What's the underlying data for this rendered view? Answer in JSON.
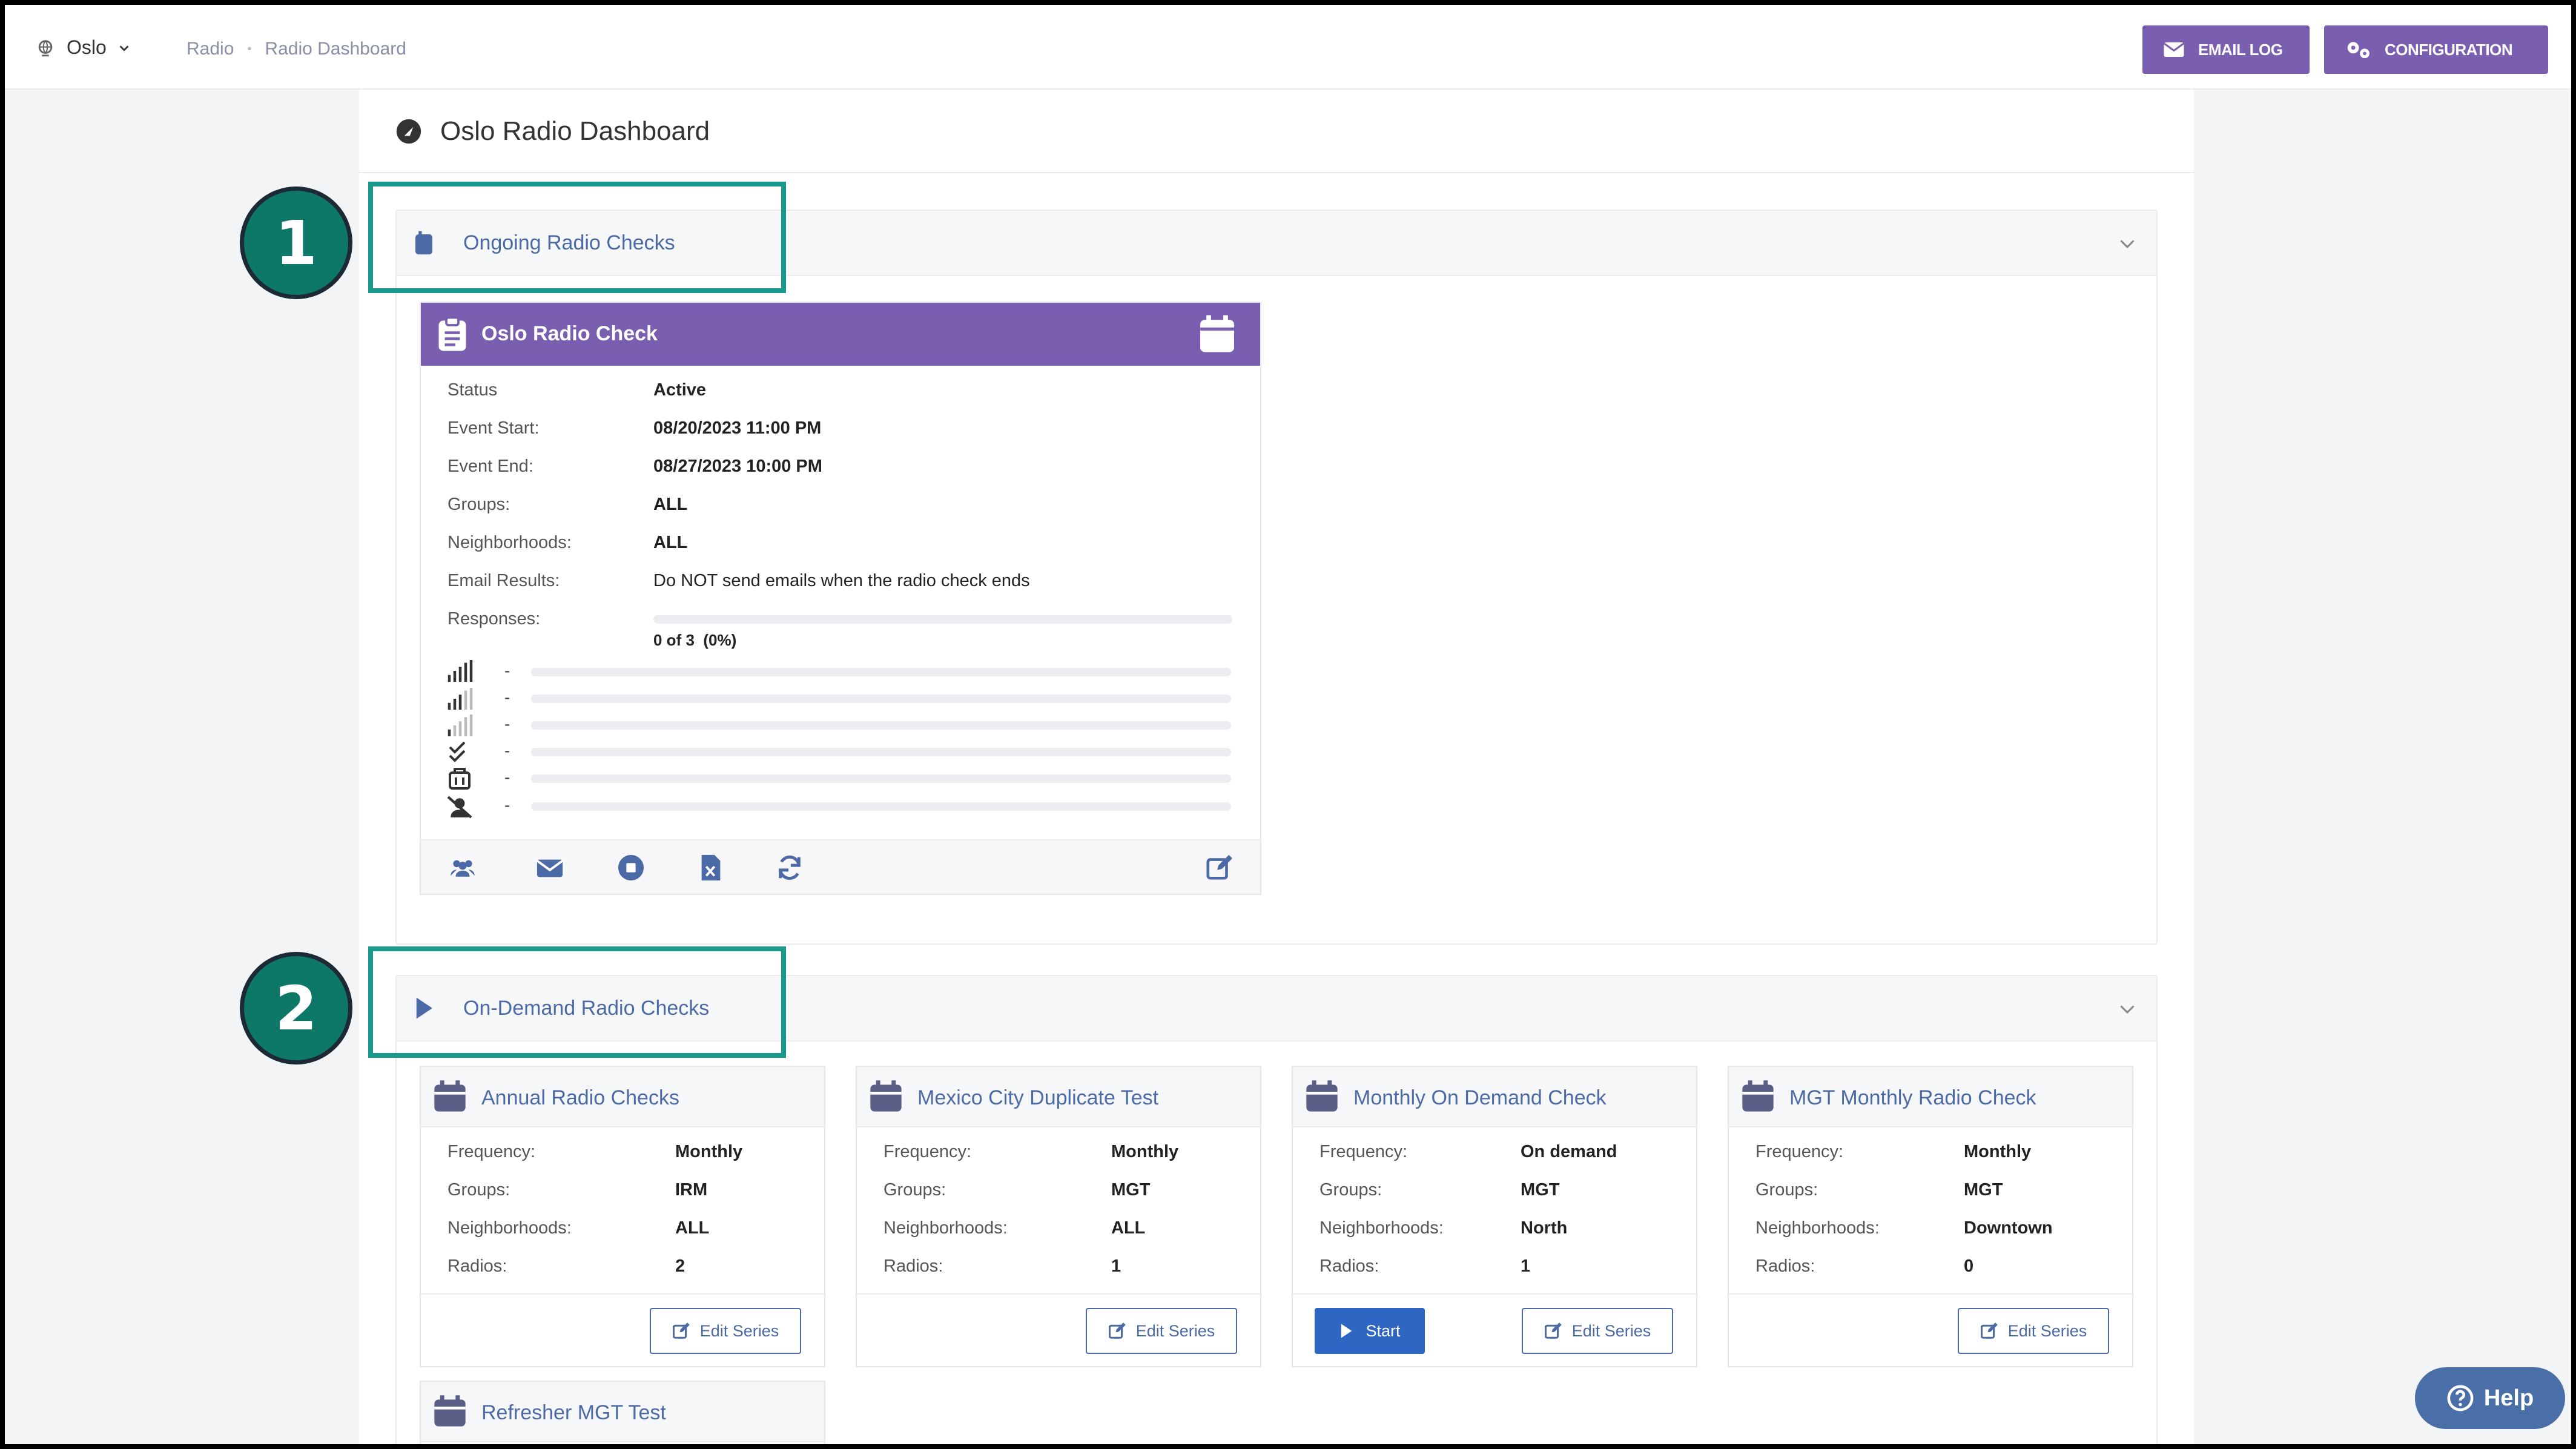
{
  "header": {
    "site": "Oslo",
    "breadcrumb": [
      "Radio",
      "Radio Dashboard"
    ],
    "email_log": "EMAIL LOG",
    "configuration": "CONFIGURATION"
  },
  "page": {
    "title": "Oslo Radio Dashboard"
  },
  "ongoing": {
    "section_title": "Ongoing Radio Checks",
    "card": {
      "title": "Oslo Radio Check",
      "rows": [
        {
          "label": "Status",
          "value": "Active"
        },
        {
          "label": "Event Start:",
          "value": "08/20/2023 11:00 PM"
        },
        {
          "label": "Event End:",
          "value": "08/27/2023 10:00 PM"
        },
        {
          "label": "Groups:",
          "value": "ALL"
        },
        {
          "label": "Neighborhoods:",
          "value": "ALL"
        },
        {
          "label": "Email Results:",
          "value": "Do NOT send emails when the radio check ends"
        }
      ],
      "responses_label": "Responses:",
      "responses_value": "0 of 3  (0%)",
      "responses_fraction": 0,
      "signal_rows": [
        "-",
        "-",
        "-",
        "-",
        "-",
        "-"
      ]
    }
  },
  "ondemand": {
    "section_title": "On-Demand Radio Checks",
    "labels": {
      "frequency": "Frequency:",
      "groups": "Groups:",
      "neighborhoods": "Neighborhoods:",
      "radios": "Radios:"
    },
    "edit_label": "Edit Series",
    "start_label": "Start",
    "cards": [
      {
        "title": "Annual Radio Checks",
        "frequency": "Monthly",
        "groups": "IRM",
        "neighborhoods": "ALL",
        "radios": "2"
      },
      {
        "title": "Mexico City Duplicate Test",
        "frequency": "Monthly",
        "groups": "MGT",
        "neighborhoods": "ALL",
        "radios": "1"
      },
      {
        "title": "Monthly On Demand Check",
        "frequency": "On demand",
        "groups": "MGT",
        "neighborhoods": "North",
        "radios": "1"
      },
      {
        "title": "MGT Monthly Radio Check",
        "frequency": "Monthly",
        "groups": "MGT",
        "neighborhoods": "Downtown",
        "radios": "0"
      },
      {
        "title": "Refresher MGT Test"
      }
    ]
  },
  "annotations": [
    "1",
    "2"
  ],
  "help": "Help",
  "colors": {
    "accent": "#7a5fb0",
    "link": "#4c6aa6",
    "annotation": "#1a9a8c",
    "start": "#2f66c4"
  }
}
